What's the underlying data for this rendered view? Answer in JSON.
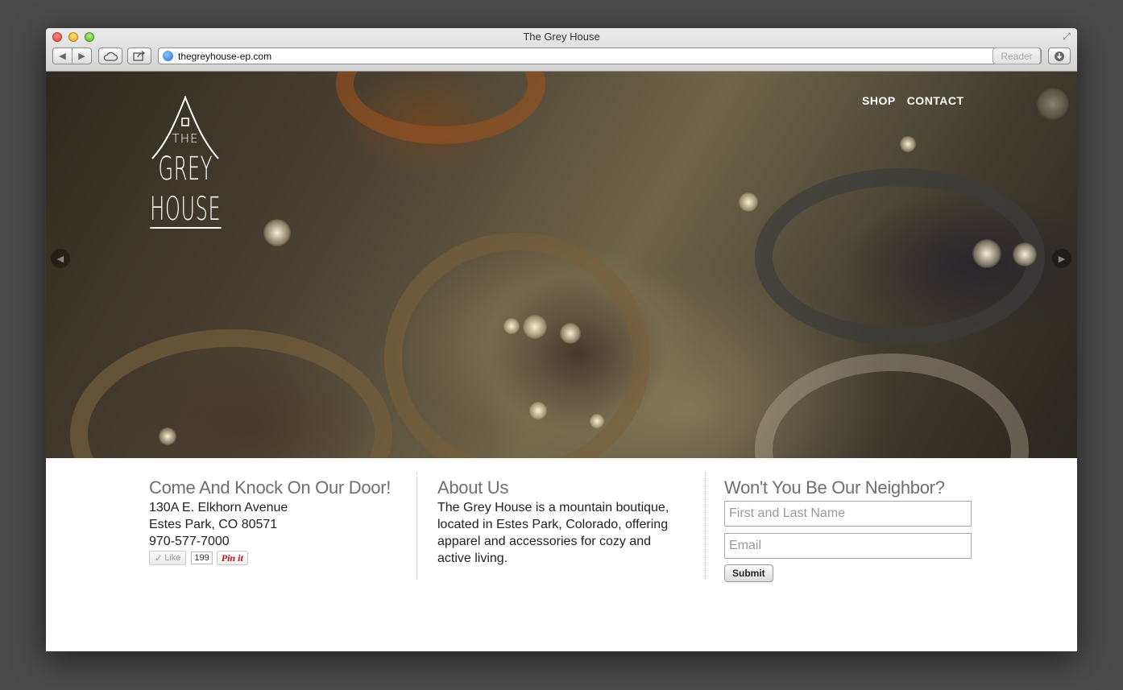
{
  "window": {
    "title": "The Grey House",
    "url": "thegreyhouse-ep.com",
    "reader_label": "Reader"
  },
  "logo": {
    "line1": "THE",
    "line2": "GREY",
    "line3": "HOUSE"
  },
  "nav": {
    "items": [
      {
        "label": "SHOP"
      },
      {
        "label": "CONTACT"
      }
    ]
  },
  "slider": {
    "prev_icon": "chevron-left-icon",
    "next_icon": "chevron-right-icon"
  },
  "visit": {
    "heading": "Come And Knock On Our Door!",
    "address_line1": "130A E. Elkhorn Avenue",
    "address_line2": "Estes Park, CO 80571",
    "phone": "970-577-7000",
    "like_label": "Like",
    "like_count": "199",
    "pin_label": "Pin it"
  },
  "about": {
    "heading": "About Us",
    "text": "The Grey House is a mountain boutique, located in Estes Park, Colorado, offering apparel and accessories for cozy and active living."
  },
  "newsletter": {
    "heading": "Won't You Be Our Neighbor?",
    "name_placeholder": "First and Last Name",
    "email_placeholder": "Email",
    "submit_label": "Submit"
  },
  "colors": {
    "heading_grey": "#6f6f6f",
    "body_text": "#222222",
    "pin_red": "#b5121b"
  }
}
